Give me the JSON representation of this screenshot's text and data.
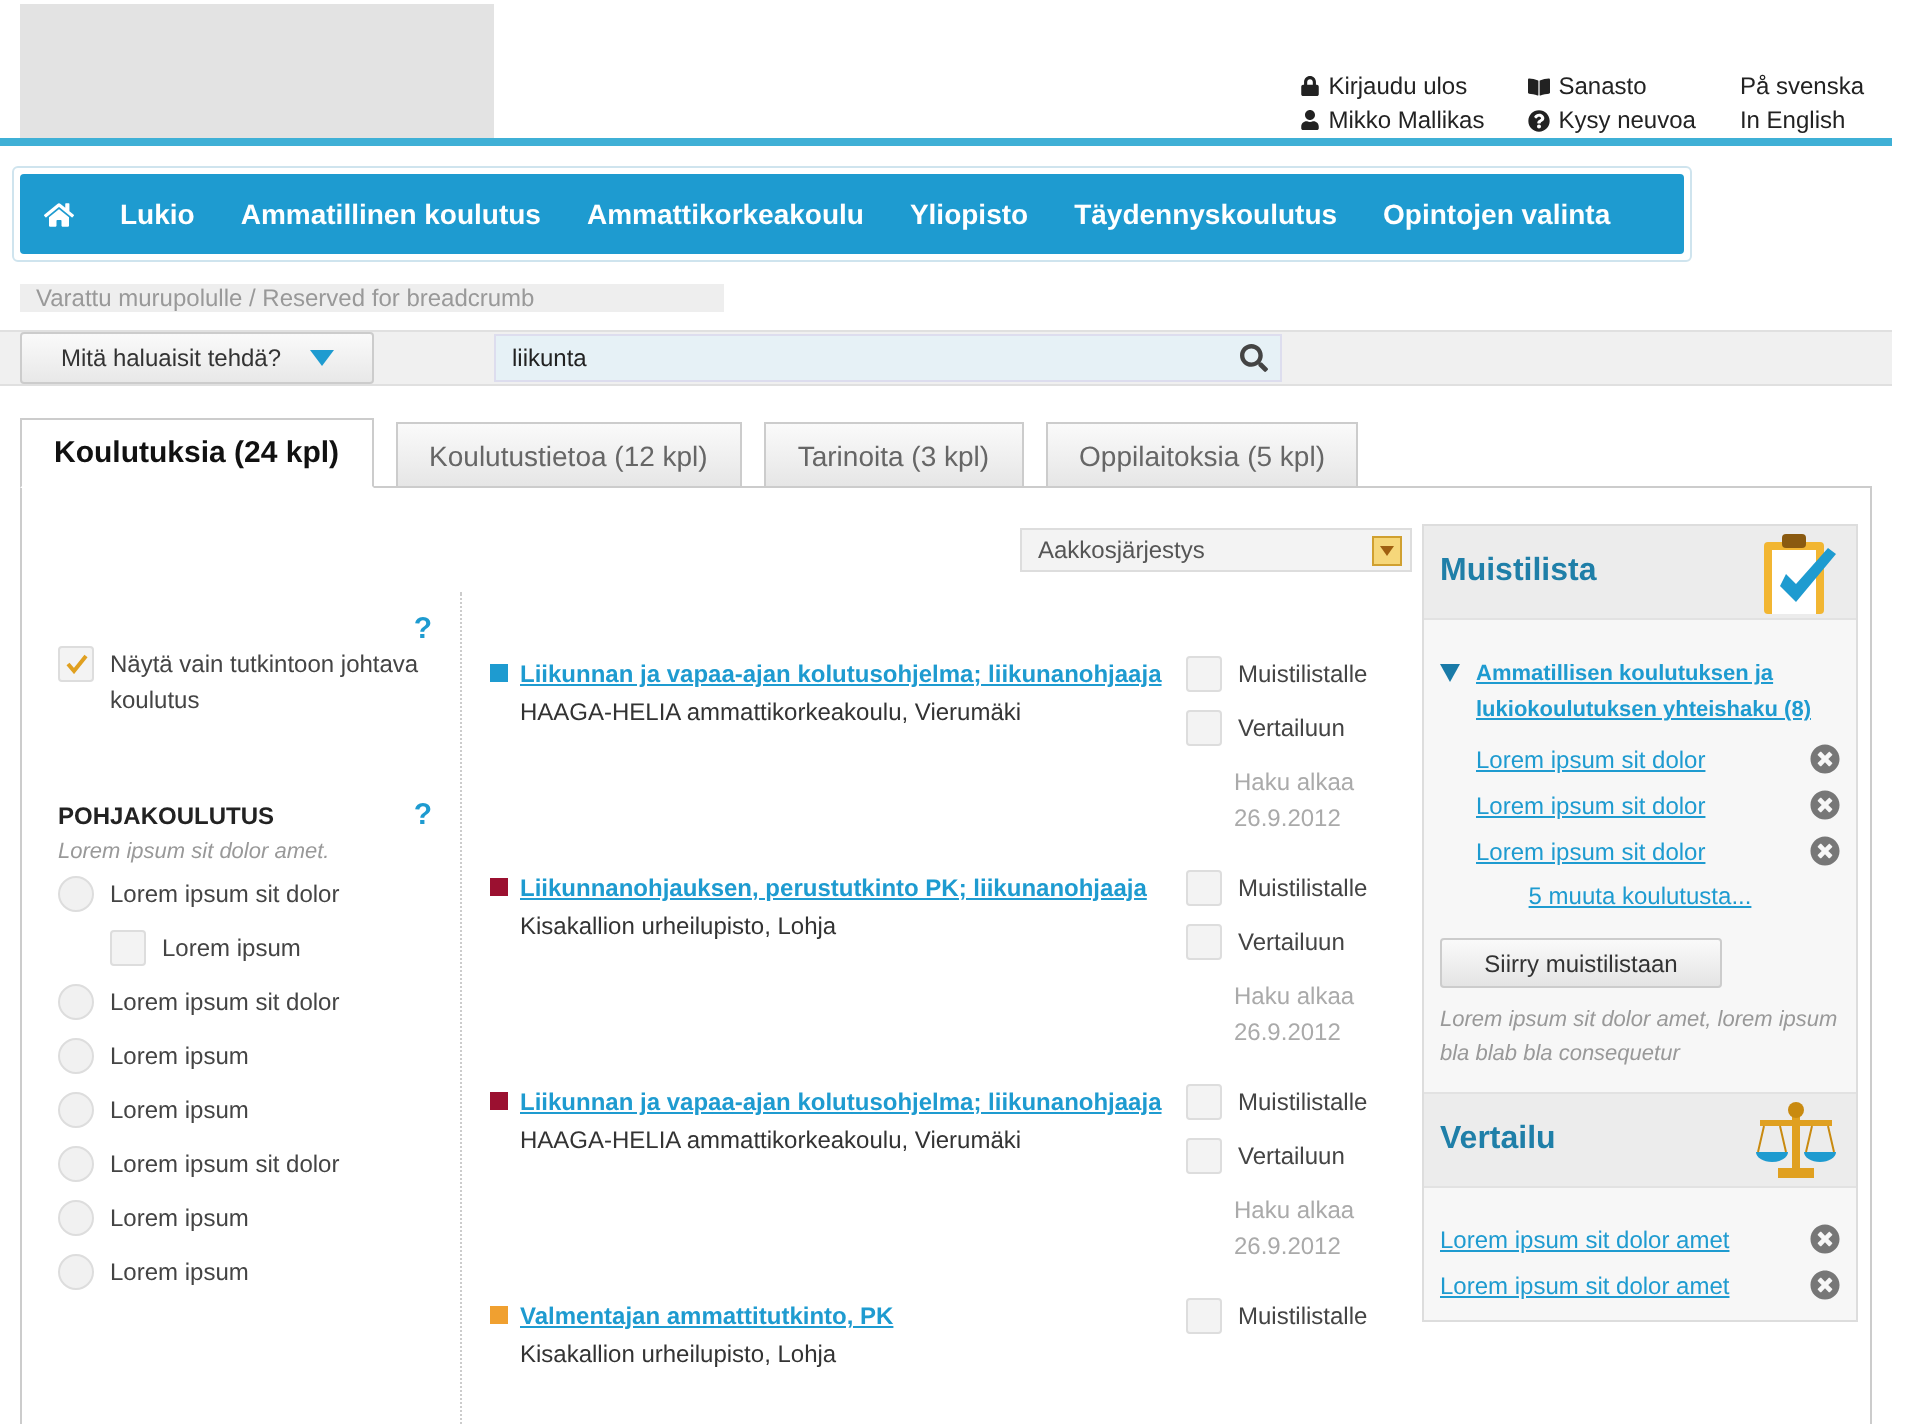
{
  "header": {
    "links": [
      {
        "kind": "lock",
        "label": "Kirjaudu ulos"
      },
      {
        "kind": "book",
        "label": "Sanasto"
      },
      {
        "kind": "plain",
        "label": "På svenska"
      },
      {
        "kind": "user",
        "label": "Mikko Mallikas"
      },
      {
        "kind": "help",
        "label": "Kysy neuvoa"
      },
      {
        "kind": "plain",
        "label": "In English"
      }
    ]
  },
  "nav": {
    "items": [
      "Lukio",
      "Ammatillinen koulutus",
      "Ammattikorkeakoulu",
      "Yliopisto",
      "Täydennyskoulutus",
      "Opintojen valinta"
    ]
  },
  "breadcrumb": "Varattu murupolulle / Reserved for breadcrumb",
  "search": {
    "action_menu": "Mitä haluaisit tehdä?",
    "value": "liikunta"
  },
  "tabs": [
    {
      "label": "Koulutuksia (24 kpl)",
      "selected": true
    },
    {
      "label": "Koulutustietoa (12 kpl)",
      "selected": false
    },
    {
      "label": "Tarinoita (3 kpl)",
      "selected": false
    },
    {
      "label": "Oppilaitoksia (5 kpl)",
      "selected": false
    }
  ],
  "sort": "Aakkosjärjestys",
  "filters": {
    "help": "?",
    "degree_only": {
      "label": "Näytä vain tutkintoon johtava koulutus",
      "checked": true
    },
    "section": {
      "title": "POHJAKOULUTUS",
      "help": "?",
      "hint": "Lorem ipsum sit dolor amet.",
      "options": [
        {
          "kind": "radio",
          "label": "Lorem ipsum sit dolor",
          "selected": false,
          "children": [
            {
              "kind": "checkbox",
              "label": "Lorem ipsum",
              "selected": false
            }
          ]
        },
        {
          "kind": "radio",
          "label": "Lorem ipsum sit dolor",
          "selected": false
        },
        {
          "kind": "radio",
          "label": "Lorem ipsum",
          "selected": false
        },
        {
          "kind": "radio",
          "label": "Lorem ipsum",
          "selected": false
        },
        {
          "kind": "radio",
          "label": "Lorem ipsum sit dolor",
          "selected": false
        },
        {
          "kind": "radio",
          "label": "Lorem ipsum",
          "selected": false
        },
        {
          "kind": "radio",
          "label": "Lorem ipsum",
          "selected": false
        }
      ]
    }
  },
  "results": [
    {
      "color": "#1e9bd0",
      "title": "Liikunnan ja vapaa-ajan kolutusohjelma; liikunanohjaaja",
      "school": "HAAGA-HELIA ammattikorkeakoulu, Vierumäki",
      "memo": {
        "label": "Muistilistalle",
        "checked": false
      },
      "compare": {
        "label": "Vertailuun",
        "checked": false
      },
      "haku": "Haku alkaa",
      "date": "26.9.2012"
    },
    {
      "color": "#9b1030",
      "title": "Liikunnanohjauksen, perustutkinto PK; liikunanohjaaja",
      "school": "Kisakallion urheilupisto, Lohja",
      "memo": {
        "label": "Muistilistalle",
        "checked": false
      },
      "compare": {
        "label": "Vertailuun",
        "checked": false
      },
      "haku": "Haku alkaa",
      "date": "26.9.2012"
    },
    {
      "color": "#9b1030",
      "title": "Liikunnan ja vapaa-ajan kolutusohjelma; liikunanohjaaja",
      "school": "HAAGA-HELIA ammattikorkeakoulu, Vierumäki",
      "memo": {
        "label": "Muistilistalle",
        "checked": false
      },
      "compare": {
        "label": "Vertailuun",
        "checked": false
      },
      "haku": "Haku alkaa",
      "date": "26.9.2012"
    },
    {
      "color": "#f0a030",
      "title": "Valmentajan ammattitutkinto, PK",
      "school": "Kisakallion urheilupisto, Lohja",
      "memo": {
        "label": "Muistilistalle",
        "checked": false
      }
    }
  ],
  "memo_list": {
    "title": "Muistilista",
    "group": {
      "title": "Ammatillisen koulutuksen ja lukiokoulutuksen yhteishaku (8)",
      "expanded": true,
      "items": [
        "Lorem ipsum sit dolor",
        "Lorem ipsum sit dolor",
        "Lorem ipsum sit dolor"
      ],
      "more": "5 muuta koulutusta..."
    },
    "button": "Siirry muistilistaan",
    "note": "Lorem ipsum sit dolor amet, lorem ipsum bla blab bla consequetur"
  },
  "comparison": {
    "title": "Vertailu",
    "items": [
      "Lorem ipsum sit dolor amet",
      "Lorem ipsum sit dolor amet"
    ]
  }
}
